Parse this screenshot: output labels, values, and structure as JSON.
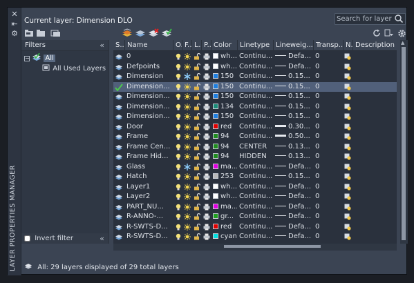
{
  "panel_title": "LAYER PROPERTIES MANAGER",
  "current_layer_label": "Current layer: Dimension DLO",
  "search": {
    "placeholder": "Search for layer"
  },
  "filters": {
    "header": "Filters",
    "tree": [
      {
        "label": "All",
        "selected": true
      },
      {
        "label": "All Used Layers",
        "selected": false
      }
    ],
    "invert_label": "Invert filter",
    "invert_checked": false
  },
  "columns": [
    "S...",
    "Name",
    "O...",
    "F...",
    "L...",
    "P...",
    "Color",
    "Linetype",
    "Lineweig...",
    "Transp...",
    "N...",
    "Description"
  ],
  "layers": [
    {
      "name": "0",
      "color_name": "wh...",
      "color_hex": "#ffffff",
      "linetype": "Continu...",
      "lineweight": "Defa...",
      "lw_thick": false,
      "transparency": "0",
      "current": false,
      "frozen": false
    },
    {
      "name": "Defpoints",
      "color_name": "wh...",
      "color_hex": "#ffffff",
      "linetype": "Continu...",
      "lineweight": "Defa...",
      "lw_thick": false,
      "transparency": "0",
      "current": false,
      "frozen": false
    },
    {
      "name": "Dimension",
      "color_name": "150",
      "color_hex": "#1e7fe0",
      "linetype": "Continu...",
      "lineweight": "0.15...",
      "lw_thick": false,
      "transparency": "0",
      "current": false,
      "frozen": true
    },
    {
      "name": "Dimension...",
      "color_name": "150",
      "color_hex": "#1e7fe0",
      "linetype": "Continu...",
      "lineweight": "0.15...",
      "lw_thick": false,
      "transparency": "0",
      "current": true,
      "frozen": false
    },
    {
      "name": "Dimension...",
      "color_name": "150",
      "color_hex": "#1e7fe0",
      "linetype": "Continu...",
      "lineweight": "0.15...",
      "lw_thick": false,
      "transparency": "0",
      "current": false,
      "frozen": false
    },
    {
      "name": "Dimension...",
      "color_name": "134",
      "color_hex": "#1a8c78",
      "linetype": "Continu...",
      "lineweight": "0.15...",
      "lw_thick": false,
      "transparency": "0",
      "current": false,
      "frozen": false
    },
    {
      "name": "Dimension...",
      "color_name": "150",
      "color_hex": "#1e7fe0",
      "linetype": "Continu...",
      "lineweight": "0.15...",
      "lw_thick": false,
      "transparency": "0",
      "current": false,
      "frozen": false
    },
    {
      "name": "Door",
      "color_name": "red",
      "color_hex": "#e00000",
      "linetype": "Continu...",
      "lineweight": "0.30...",
      "lw_thick": true,
      "transparency": "0",
      "current": false,
      "frozen": false
    },
    {
      "name": "Frame",
      "color_name": "94",
      "color_hex": "#1f8c1f",
      "linetype": "Continu...",
      "lineweight": "0.50...",
      "lw_thick": true,
      "transparency": "0",
      "current": false,
      "frozen": false
    },
    {
      "name": "Frame Cen...",
      "color_name": "94",
      "color_hex": "#1f8c1f",
      "linetype": "CENTER",
      "lineweight": "0.13...",
      "lw_thick": false,
      "transparency": "0",
      "current": false,
      "frozen": false
    },
    {
      "name": "Frame Hid...",
      "color_name": "94",
      "color_hex": "#1f8c1f",
      "linetype": "HIDDEN",
      "lineweight": "0.13...",
      "lw_thick": false,
      "transparency": "0",
      "current": false,
      "frozen": false
    },
    {
      "name": "Glass",
      "color_name": "ma...",
      "color_hex": "#e000e0",
      "linetype": "Continu...",
      "lineweight": "Defa...",
      "lw_thick": false,
      "transparency": "0",
      "current": false,
      "frozen": true
    },
    {
      "name": "Hatch",
      "color_name": "253",
      "color_hex": "#b8b8b8",
      "linetype": "Continu...",
      "lineweight": "0.15...",
      "lw_thick": false,
      "transparency": "0",
      "current": false,
      "frozen": false
    },
    {
      "name": "Layer1",
      "color_name": "wh...",
      "color_hex": "#ffffff",
      "linetype": "Continu...",
      "lineweight": "Defa...",
      "lw_thick": false,
      "transparency": "0",
      "current": false,
      "frozen": false
    },
    {
      "name": "Layer2",
      "color_name": "wh...",
      "color_hex": "#ffffff",
      "linetype": "Continu...",
      "lineweight": "Defa...",
      "lw_thick": false,
      "transparency": "0",
      "current": false,
      "frozen": false
    },
    {
      "name": "PART_NU...",
      "color_name": "ma...",
      "color_hex": "#e000e0",
      "linetype": "Continu...",
      "lineweight": "Defa...",
      "lw_thick": false,
      "transparency": "0",
      "current": false,
      "frozen": false
    },
    {
      "name": "R-ANNO-...",
      "color_name": "gr...",
      "color_hex": "#1fa01f",
      "linetype": "Continu...",
      "lineweight": "Defa...",
      "lw_thick": false,
      "transparency": "0",
      "current": false,
      "frozen": false
    },
    {
      "name": "R-SWTS-D...",
      "color_name": "red",
      "color_hex": "#e00000",
      "linetype": "Continu...",
      "lineweight": "Defa...",
      "lw_thick": false,
      "transparency": "0",
      "current": false,
      "frozen": false
    },
    {
      "name": "R-SWTS-D...",
      "color_name": "cyan",
      "color_hex": "#00e0e0",
      "linetype": "Continu...",
      "lineweight": "Defa...",
      "lw_thick": false,
      "transparency": "0",
      "current": false,
      "frozen": false
    }
  ],
  "selected_row": 3,
  "status_text": "All: 29 layers displayed of 29 total layers"
}
